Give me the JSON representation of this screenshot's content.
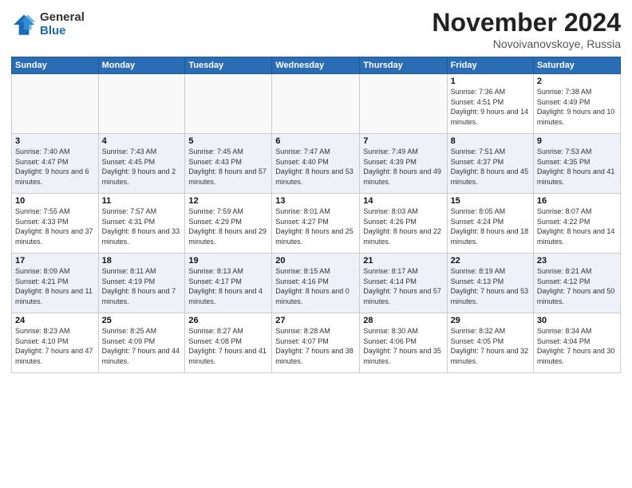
{
  "logo": {
    "general": "General",
    "blue": "Blue"
  },
  "title": "November 2024",
  "location": "Novoivanovskoye, Russia",
  "days_of_week": [
    "Sunday",
    "Monday",
    "Tuesday",
    "Wednesday",
    "Thursday",
    "Friday",
    "Saturday"
  ],
  "weeks": [
    [
      {
        "day": "",
        "info": ""
      },
      {
        "day": "",
        "info": ""
      },
      {
        "day": "",
        "info": ""
      },
      {
        "day": "",
        "info": ""
      },
      {
        "day": "",
        "info": ""
      },
      {
        "day": "1",
        "info": "Sunrise: 7:36 AM\nSunset: 4:51 PM\nDaylight: 9 hours and 14 minutes."
      },
      {
        "day": "2",
        "info": "Sunrise: 7:38 AM\nSunset: 4:49 PM\nDaylight: 9 hours and 10 minutes."
      }
    ],
    [
      {
        "day": "3",
        "info": "Sunrise: 7:40 AM\nSunset: 4:47 PM\nDaylight: 9 hours and 6 minutes."
      },
      {
        "day": "4",
        "info": "Sunrise: 7:43 AM\nSunset: 4:45 PM\nDaylight: 9 hours and 2 minutes."
      },
      {
        "day": "5",
        "info": "Sunrise: 7:45 AM\nSunset: 4:43 PM\nDaylight: 8 hours and 57 minutes."
      },
      {
        "day": "6",
        "info": "Sunrise: 7:47 AM\nSunset: 4:40 PM\nDaylight: 8 hours and 53 minutes."
      },
      {
        "day": "7",
        "info": "Sunrise: 7:49 AM\nSunset: 4:39 PM\nDaylight: 8 hours and 49 minutes."
      },
      {
        "day": "8",
        "info": "Sunrise: 7:51 AM\nSunset: 4:37 PM\nDaylight: 8 hours and 45 minutes."
      },
      {
        "day": "9",
        "info": "Sunrise: 7:53 AM\nSunset: 4:35 PM\nDaylight: 8 hours and 41 minutes."
      }
    ],
    [
      {
        "day": "10",
        "info": "Sunrise: 7:55 AM\nSunset: 4:33 PM\nDaylight: 8 hours and 37 minutes."
      },
      {
        "day": "11",
        "info": "Sunrise: 7:57 AM\nSunset: 4:31 PM\nDaylight: 8 hours and 33 minutes."
      },
      {
        "day": "12",
        "info": "Sunrise: 7:59 AM\nSunset: 4:29 PM\nDaylight: 8 hours and 29 minutes."
      },
      {
        "day": "13",
        "info": "Sunrise: 8:01 AM\nSunset: 4:27 PM\nDaylight: 8 hours and 25 minutes."
      },
      {
        "day": "14",
        "info": "Sunrise: 8:03 AM\nSunset: 4:26 PM\nDaylight: 8 hours and 22 minutes."
      },
      {
        "day": "15",
        "info": "Sunrise: 8:05 AM\nSunset: 4:24 PM\nDaylight: 8 hours and 18 minutes."
      },
      {
        "day": "16",
        "info": "Sunrise: 8:07 AM\nSunset: 4:22 PM\nDaylight: 8 hours and 14 minutes."
      }
    ],
    [
      {
        "day": "17",
        "info": "Sunrise: 8:09 AM\nSunset: 4:21 PM\nDaylight: 8 hours and 11 minutes."
      },
      {
        "day": "18",
        "info": "Sunrise: 8:11 AM\nSunset: 4:19 PM\nDaylight: 8 hours and 7 minutes."
      },
      {
        "day": "19",
        "info": "Sunrise: 8:13 AM\nSunset: 4:17 PM\nDaylight: 8 hours and 4 minutes."
      },
      {
        "day": "20",
        "info": "Sunrise: 8:15 AM\nSunset: 4:16 PM\nDaylight: 8 hours and 0 minutes."
      },
      {
        "day": "21",
        "info": "Sunrise: 8:17 AM\nSunset: 4:14 PM\nDaylight: 7 hours and 57 minutes."
      },
      {
        "day": "22",
        "info": "Sunrise: 8:19 AM\nSunset: 4:13 PM\nDaylight: 7 hours and 53 minutes."
      },
      {
        "day": "23",
        "info": "Sunrise: 8:21 AM\nSunset: 4:12 PM\nDaylight: 7 hours and 50 minutes."
      }
    ],
    [
      {
        "day": "24",
        "info": "Sunrise: 8:23 AM\nSunset: 4:10 PM\nDaylight: 7 hours and 47 minutes."
      },
      {
        "day": "25",
        "info": "Sunrise: 8:25 AM\nSunset: 4:09 PM\nDaylight: 7 hours and 44 minutes."
      },
      {
        "day": "26",
        "info": "Sunrise: 8:27 AM\nSunset: 4:08 PM\nDaylight: 7 hours and 41 minutes."
      },
      {
        "day": "27",
        "info": "Sunrise: 8:28 AM\nSunset: 4:07 PM\nDaylight: 7 hours and 38 minutes."
      },
      {
        "day": "28",
        "info": "Sunrise: 8:30 AM\nSunset: 4:06 PM\nDaylight: 7 hours and 35 minutes."
      },
      {
        "day": "29",
        "info": "Sunrise: 8:32 AM\nSunset: 4:05 PM\nDaylight: 7 hours and 32 minutes."
      },
      {
        "day": "30",
        "info": "Sunrise: 8:34 AM\nSunset: 4:04 PM\nDaylight: 7 hours and 30 minutes."
      }
    ]
  ]
}
